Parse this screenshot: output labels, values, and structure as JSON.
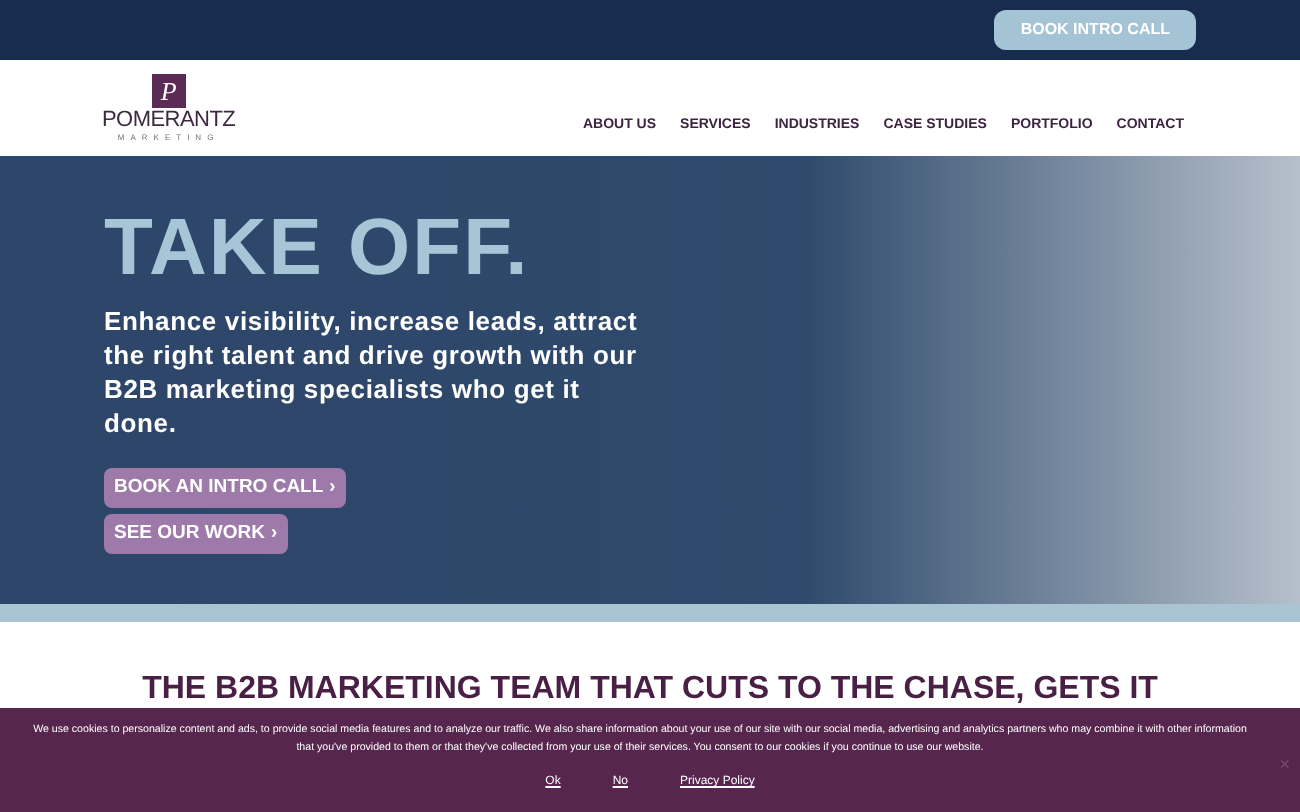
{
  "top_bar": {
    "button": "BOOK INTRO CALL"
  },
  "header": {
    "logo": {
      "mark": "P",
      "name": "POMERANTZ",
      "tagline": "MARKETING"
    },
    "nav": [
      "ABOUT US",
      "SERVICES",
      "INDUSTRIES",
      "CASE STUDIES",
      "PORTFOLIO",
      "CONTACT"
    ]
  },
  "hero": {
    "title": "TAKE OFF.",
    "text": "Enhance visibility, increase leads, attract the right talent and drive growth with our B2B marketing specialists who get it done.",
    "buttons": [
      {
        "label": "BOOK AN INTRO CALL",
        "chevron": "›"
      },
      {
        "label": "SEE OUR WORK",
        "chevron": "›"
      }
    ]
  },
  "section": {
    "heading": "THE B2B MARKETING TEAM THAT CUTS TO THE CHASE, GETS IT"
  },
  "cookie_bar": {
    "text": "We use cookies to personalize content and ads, to provide social media features and to analyze our traffic. We also share information about your use of our site with our social media, advertising and analytics partners who may combine it with other information that you've provided to them or that they've collected from your use of their services. You consent to our cookies if you continue to use our website.",
    "links": [
      "Ok",
      "No",
      "Privacy Policy"
    ],
    "close": "×"
  }
}
